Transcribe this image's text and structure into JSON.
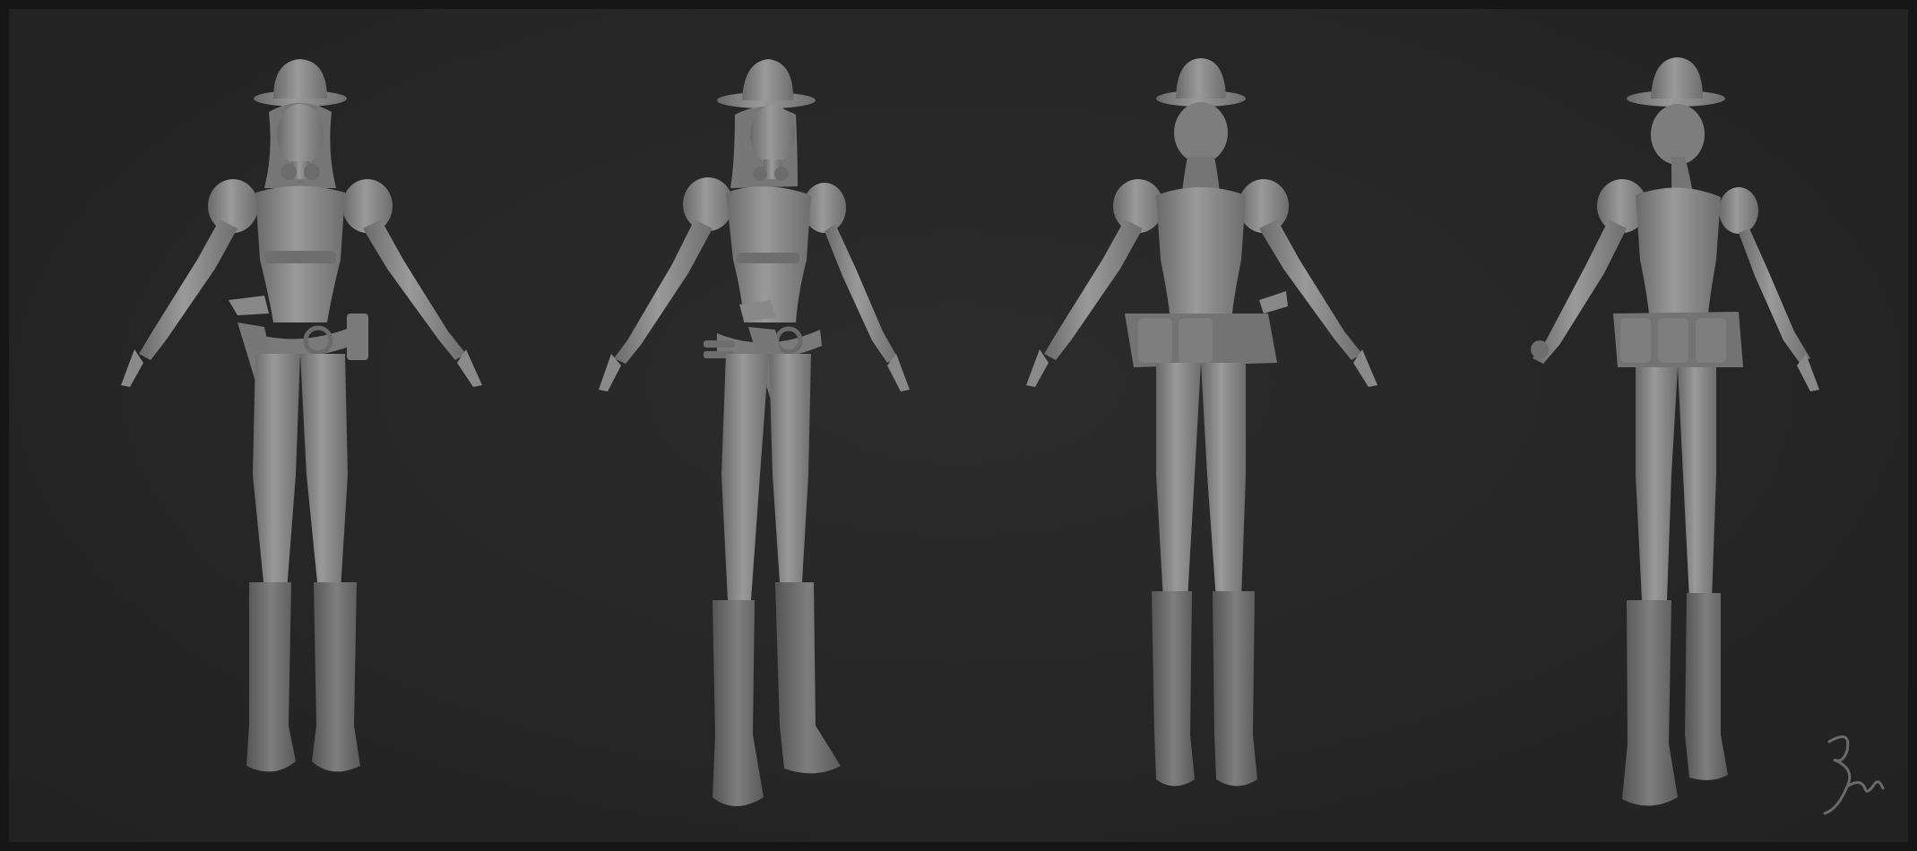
{
  "scene": {
    "background_color": "#262626",
    "frame_color": "#161616",
    "clay_color": "#8c8c8c",
    "clay_shadow": "#5e5e5e",
    "clay_highlight": "#a8a8a8"
  },
  "views": [
    {
      "view": "front"
    },
    {
      "view": "three-quarter-front"
    },
    {
      "view": "back"
    },
    {
      "view": "three-quarter-back"
    }
  ],
  "signature": {
    "text": "Bm"
  }
}
